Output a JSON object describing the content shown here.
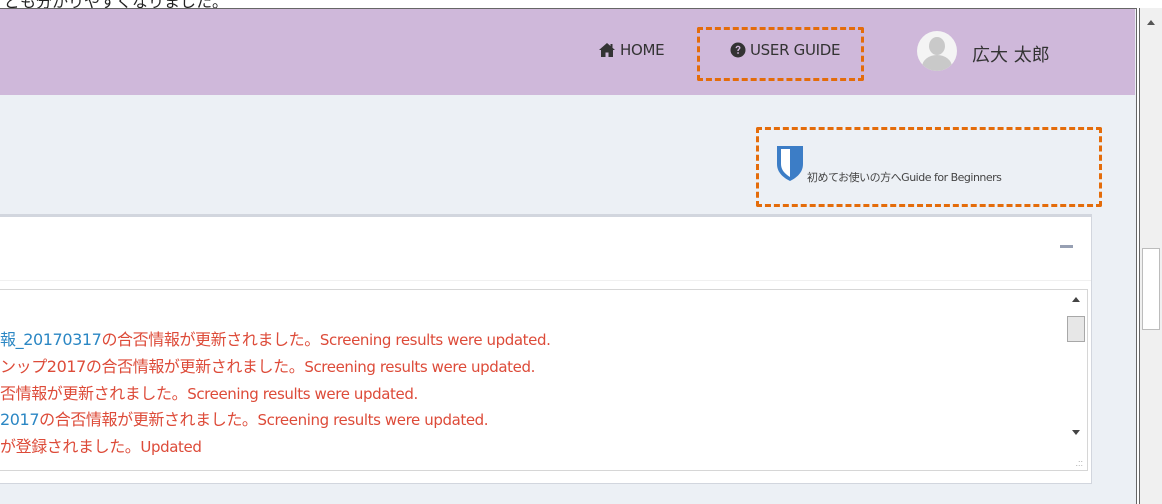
{
  "top_caption": "ども分かりやすくなりました。",
  "header": {
    "home_label": "HOME",
    "user_guide_label": "USER GUIDE",
    "user_name": "広大 太郎",
    "icons": {
      "home": "home-icon",
      "user_guide": "question-circle-icon",
      "avatar": "user-avatar"
    }
  },
  "beginner_guide": {
    "label": "初めてお使いの方へGuide for Beginners",
    "icon": "shield-icon"
  },
  "panel": {
    "collapse_icon": "minus-icon",
    "notices": [
      {
        "link": "報_20170317",
        "message": "の合否情報が更新されました。",
        "english": "Screening results were updated."
      },
      {
        "link": "",
        "message": "ンップ2017の合否情報が更新されました。",
        "english": "Screening results were updated."
      },
      {
        "link": "",
        "message": "否情報が更新されました。",
        "english": "Screening results were updated."
      },
      {
        "link": "2017",
        "message": "の合否情報が更新されました。",
        "english": "Screening results were updated."
      },
      {
        "link": "",
        "message": "が登録されました。",
        "english": "Updated"
      }
    ]
  },
  "colors": {
    "header_bg": "#cfb8da",
    "page_bg": "#ecf0f5",
    "highlight_border": "#e46c0a",
    "link": "#2b87c4",
    "alert_text": "#dd4b39",
    "shield": "#3c7dc6"
  }
}
